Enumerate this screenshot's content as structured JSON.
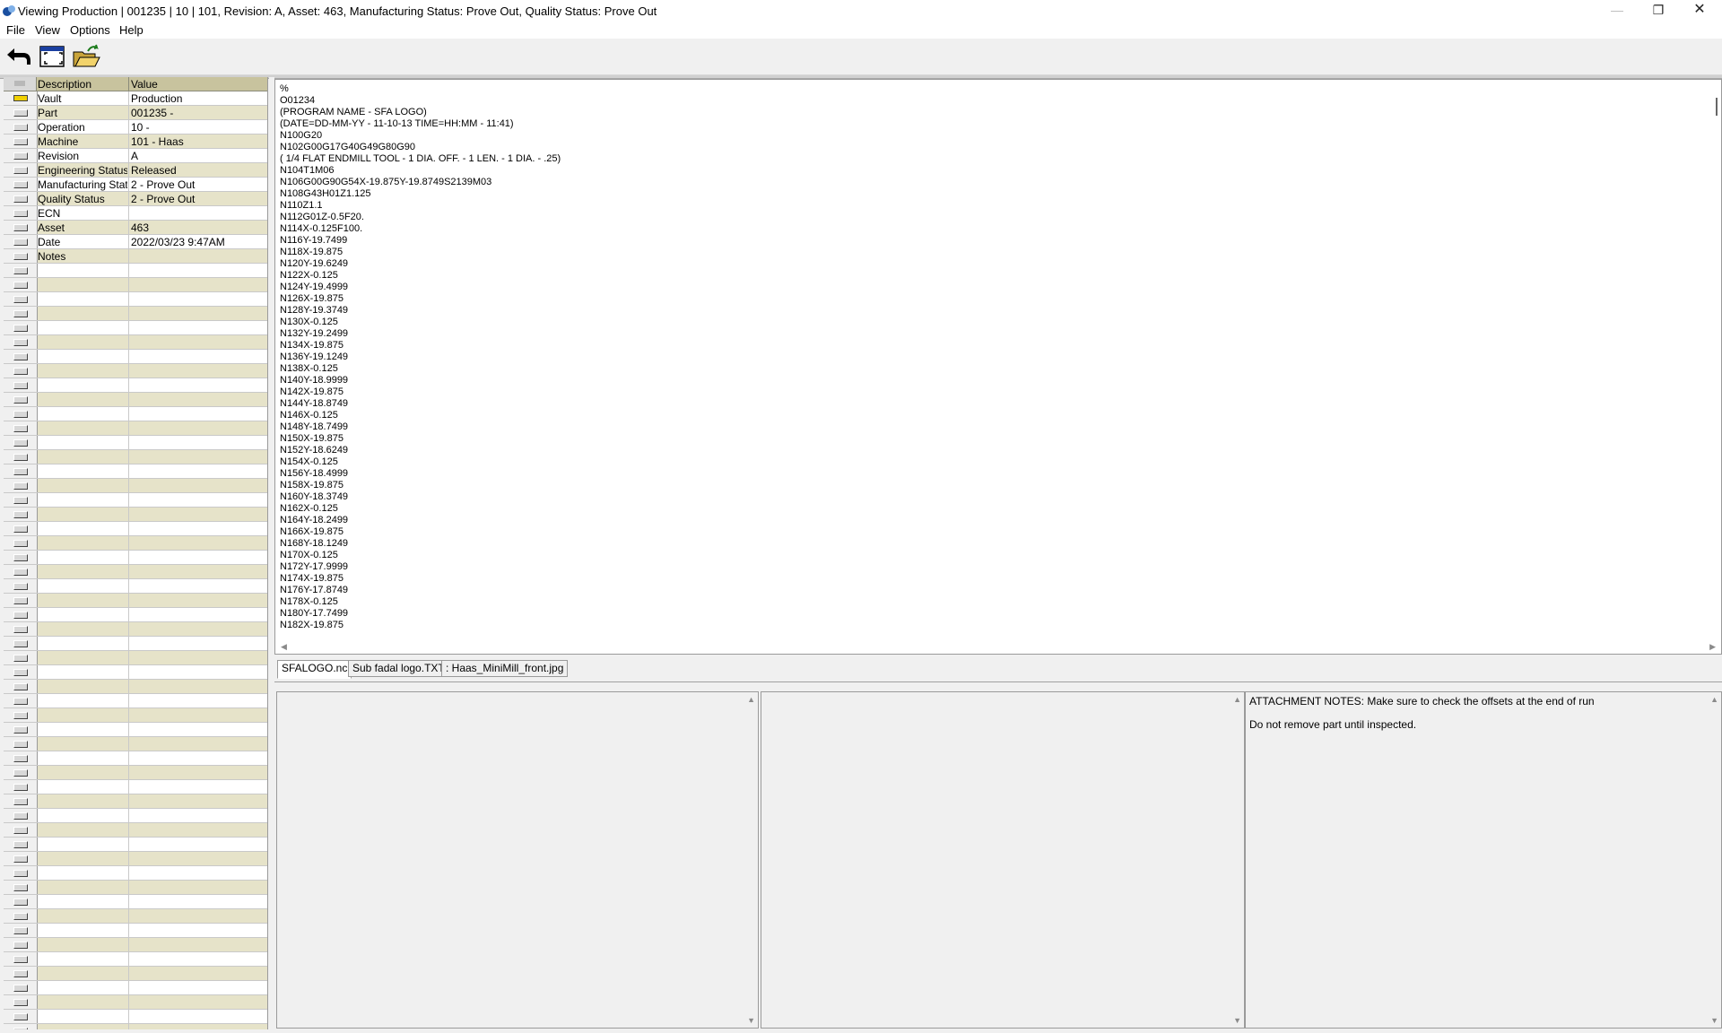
{
  "window": {
    "title": "Viewing Production | 001235 | 10 | 101, Revision: A, Asset: 463, Manufacturing Status: Prove Out, Quality Status: Prove Out",
    "min_glyph": "—",
    "max_glyph": "❐",
    "close_glyph": "✕"
  },
  "menu": [
    "File",
    "View",
    "Options",
    "Help"
  ],
  "toolbar": {
    "icons": [
      "back-arrow-icon",
      "fullscreen-icon",
      "open-folder-icon"
    ]
  },
  "grid": {
    "header": {
      "description": "Description",
      "value": "Value"
    },
    "rows": [
      {
        "description": "Vault",
        "value": "Production"
      },
      {
        "description": "Part",
        "value": "001235 -"
      },
      {
        "description": "Operation",
        "value": "10 -"
      },
      {
        "description": "Machine",
        "value": "101 - Haas"
      },
      {
        "description": "Revision",
        "value": "A"
      },
      {
        "description": "Engineering Status",
        "value": "Released"
      },
      {
        "description": "Manufacturing Status",
        "value": "2 - Prove Out"
      },
      {
        "description": "Quality Status",
        "value": "2 - Prove Out"
      },
      {
        "description": "ECN",
        "value": ""
      },
      {
        "description": "Asset",
        "value": "463"
      },
      {
        "description": "Date",
        "value": "2022/03/23  9:47AM"
      },
      {
        "description": "Notes",
        "value": ""
      }
    ]
  },
  "code": {
    "lines": [
      "%",
      "O01234",
      "(PROGRAM NAME - SFA LOGO)",
      "(DATE=DD-MM-YY - 11-10-13 TIME=HH:MM - 11:41)",
      "N100G20",
      "N102G00G17G40G49G80G90",
      "( 1/4 FLAT ENDMILL TOOL - 1 DIA. OFF. - 1 LEN. - 1 DIA. - .25)",
      "N104T1M06",
      "N106G00G90G54X-19.875Y-19.8749S2139M03",
      "N108G43H01Z1.125",
      "N110Z1.1",
      "N112G01Z-0.5F20.",
      "N114X-0.125F100.",
      "N116Y-19.7499",
      "N118X-19.875",
      "N120Y-19.6249",
      "N122X-0.125",
      "N124Y-19.4999",
      "N126X-19.875",
      "N128Y-19.3749",
      "N130X-0.125",
      "N132Y-19.2499",
      "N134X-19.875",
      "N136Y-19.1249",
      "N138X-0.125",
      "N140Y-18.9999",
      "N142X-19.875",
      "N144Y-18.8749",
      "N146X-0.125",
      "N148Y-18.7499",
      "N150X-19.875",
      "N152Y-18.6249",
      "N154X-0.125",
      "N156Y-18.4999",
      "N158X-19.875",
      "N160Y-18.3749",
      "N162X-0.125",
      "N164Y-18.2499",
      "N166X-19.875",
      "N168Y-18.1249",
      "N170X-0.125",
      "N172Y-17.9999",
      "N174X-19.875",
      "N176Y-17.8749",
      "N178X-0.125",
      "N180Y-17.7499",
      "N182X-19.875"
    ]
  },
  "tabs": [
    {
      "label": "SFALOGO.nc",
      "active": true
    },
    {
      "label": "Sub fadal logo.TXT",
      "active": false
    },
    {
      "label": ": Haas_MiniMill_front.jpg",
      "active": false
    }
  ],
  "notes": {
    "line1": "ATTACHMENT NOTES: Make sure to check the offsets at the end of run",
    "line2": "Do not remove part until inspected."
  },
  "scroll": {
    "left": "◀",
    "right": "▶",
    "up": "▲",
    "down": "▼"
  },
  "colors": {
    "grid_alt_row": "#e6e3c9",
    "grid_header": "#c8c39e",
    "current_row_marker": "#f0d000"
  }
}
